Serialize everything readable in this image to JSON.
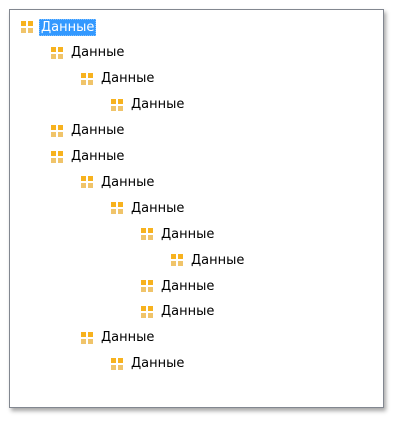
{
  "tree": {
    "icon": "data-folder-icon",
    "icon_colors": {
      "top": "#f7b21e",
      "bottom": "#f0c46a"
    },
    "selection_color": "#3399ff",
    "nodes": [
      {
        "label": "Данные",
        "level": 0,
        "selected": true
      },
      {
        "label": "Данные",
        "level": 1,
        "selected": false
      },
      {
        "label": "Данные",
        "level": 2,
        "selected": false
      },
      {
        "label": "Данные",
        "level": 3,
        "selected": false
      },
      {
        "label": "Данные",
        "level": 1,
        "selected": false
      },
      {
        "label": "Данные",
        "level": 1,
        "selected": false
      },
      {
        "label": "Данные",
        "level": 2,
        "selected": false
      },
      {
        "label": "Данные",
        "level": 3,
        "selected": false
      },
      {
        "label": "Данные",
        "level": 4,
        "selected": false
      },
      {
        "label": "Данные",
        "level": 5,
        "selected": false
      },
      {
        "label": "Данные",
        "level": 4,
        "selected": false
      },
      {
        "label": "Данные",
        "level": 4,
        "selected": false
      },
      {
        "label": "Данные",
        "level": 2,
        "selected": false
      },
      {
        "label": "Данные",
        "level": 3,
        "selected": false
      }
    ]
  }
}
